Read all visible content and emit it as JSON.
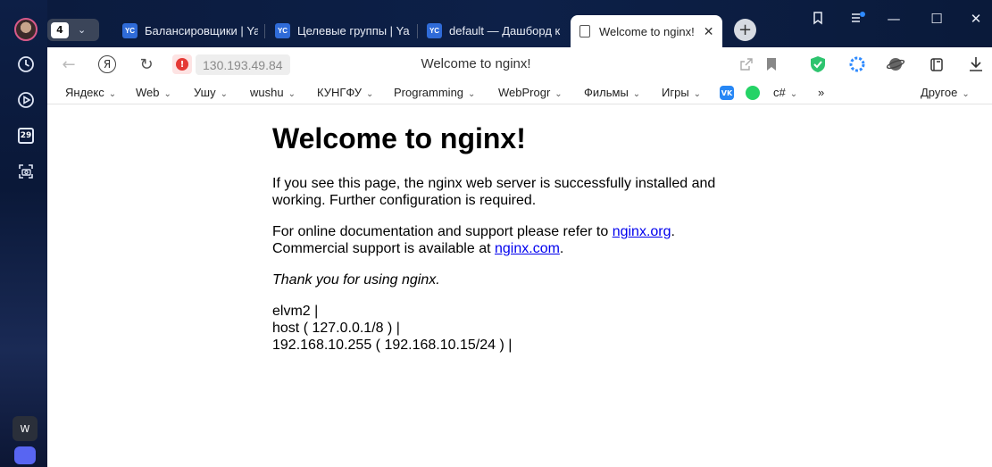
{
  "browser": {
    "tab_count": "4",
    "tabs": [
      {
        "favicon": "YC",
        "label": "Балансировщики | Ya"
      },
      {
        "favicon": "YC",
        "label": "Целевые группы | Ya"
      },
      {
        "favicon": "YC",
        "label": "default — Дашборд к"
      },
      {
        "label": "Welcome to nginx!"
      }
    ],
    "new_tab_symbol": "+",
    "window_controls": {
      "minimize": "—",
      "maximize": "☐",
      "close": "✕"
    }
  },
  "sidebar": {
    "calendar_day": "29",
    "bottom_app_letter": "W"
  },
  "addressbar": {
    "url": "130.193.49.84",
    "page_title": "Welcome to nginx!",
    "logo_letter": "Я"
  },
  "bookmarks": [
    {
      "label": "Яндекс"
    },
    {
      "label": "Web"
    },
    {
      "label": "Ушу"
    },
    {
      "label": "wushu"
    },
    {
      "label": "КУНГФУ"
    },
    {
      "label": "Programming"
    },
    {
      "label": "WebProgr"
    },
    {
      "label": "Фильмы"
    },
    {
      "label": "Игры"
    },
    {
      "label": "c#"
    }
  ],
  "bookmarks_more": "»",
  "bookmarks_other": "Другое",
  "bookmark_icons": {
    "vk": "VK"
  },
  "page": {
    "heading": "Welcome to nginx!",
    "p1": "If you see this page, the nginx web server is successfully installed and working. Further configuration is required.",
    "p2_before": "For online documentation and support please refer to ",
    "p2_link1": "nginx.org",
    "p2_mid": ".",
    "p2_line2_before": "Commercial support is available at ",
    "p2_link2": "nginx.com",
    "p2_end": ".",
    "thanks": "Thank you for using nginx.",
    "info_lines": [
      "elvm2 |",
      "host ( 127.0.0.1/8 ) |",
      "192.168.10.255 ( 192.168.10.15/24 ) |"
    ]
  },
  "colors": {
    "link": "#0000ee",
    "favicon_blue": "#2f6bd8",
    "warning_red": "#e53935",
    "shield_green": "#2ec46f"
  }
}
